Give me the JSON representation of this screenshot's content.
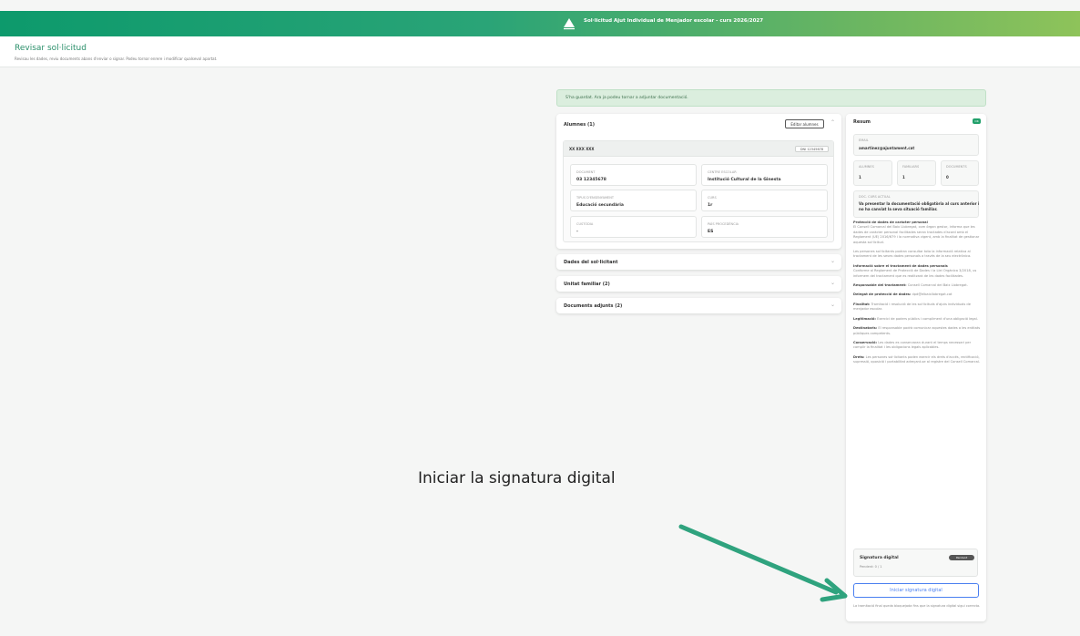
{
  "header": {
    "title": "Sol·licitud Ajut Individual de Menjador escolar - curs 2026/2027",
    "colors": {
      "green_start": "#0d9a6c",
      "green_end": "#8ec35a"
    }
  },
  "page": {
    "title": "Revisar sol·licitud",
    "subtitle": "Revisau les dades, reviu documents abans d'enviar o signar. Podeu tornar enrere i modificar qualsevol apartat."
  },
  "alert": {
    "text": "S'ha guardat. Ara ja podeu tornar a adjuntar documentació."
  },
  "students": {
    "title": "Alumnes (1)",
    "edit_label": "Editar alumnes",
    "card": {
      "name": "XX XXX XXX",
      "pill": "DNI 12345678",
      "fields": [
        {
          "label": "Document",
          "value": "03 12345678"
        },
        {
          "label": "Centre escolar",
          "value": "Institució Cultural de la Ginesta"
        },
        {
          "label": "Tipus d'ensenyament",
          "value": "Educació secundària"
        },
        {
          "label": "Curs",
          "value": "1r"
        },
        {
          "label": "Custòdia",
          "value": "-"
        },
        {
          "label": "País procedència",
          "value": "ES"
        }
      ]
    }
  },
  "sections": [
    {
      "title": "Dades del sol·licitant"
    },
    {
      "title": "Unitat familiar (2)"
    },
    {
      "title": "Documents adjunts (2)"
    }
  ],
  "summary": {
    "title": "Resum",
    "tag": "OK",
    "email_label": "Email",
    "email": "amartinez@ajuntament.cat",
    "stats": [
      {
        "label": "Alumnes",
        "value": "1"
      },
      {
        "label": "Familiars",
        "value": "1"
      },
      {
        "label": "Documents",
        "value": "0"
      }
    ],
    "doc_label": "Doc. curs actual",
    "doc_text": "Va presentar la documentació obligatòria al curs anterior i no ha canviat la seva situació familiar.",
    "legal": [
      {
        "head": "Protecció de dades de caràcter personal",
        "text": "El Consell Comarcal del Baix Llobregat, com òrgan gestor, informa que les dades de caràcter personal facilitades seran tractades d'acord amb el Reglament (UE) 2016/679 i la normativa vigent, amb la finalitat de gestionar aquesta sol·licitud."
      },
      {
        "head": "",
        "text": "Les persones sol·licitants podran consultar tota la informació relativa al tractament de les seves dades personals a través de la seu electrònica."
      },
      {
        "head": "Informació sobre el tractament de dades personals",
        "text": "Conforme al Reglament de Protecció de Dades i la Llei Orgànica 3/2018, us informem del tractament que es realitzarà de les dades facilitades."
      },
      {
        "head": "Responsable del tractament:",
        "text": "Consell Comarcal del Baix Llobregat."
      },
      {
        "head": "Delegat de protecció de dades:",
        "text": "dpd@elbaixllobregat.cat"
      },
      {
        "head": "Finalitat:",
        "text": "Tramitació i resolució de les sol·licituds d'ajuts individuals de menjador escolar."
      },
      {
        "head": "Legitimació:",
        "text": "Exercici de poders públics i compliment d'una obligació legal."
      },
      {
        "head": "Destinataris:",
        "text": "El responsable podrà comunicar aquestes dades a les entitats públiques competents."
      },
      {
        "head": "Conservació:",
        "text": "Les dades es conservaran durant el temps necessari per complir la finalitat i les obligacions legals aplicables."
      },
      {
        "head": "Drets:",
        "text": "Les persones sol·licitants poden exercir els drets d'accés, rectificació, supressió, oposició i portabilitat adreçant-se al registre del Consell Comarcal."
      }
    ],
    "signature": {
      "title": "Signatura digital",
      "subtitle": "Pendent: 0 / 1",
      "badge": "Pendent"
    },
    "sign_button": "Iniciar signatura digital",
    "footnote": "La tramitació final queda bloquejada fins que la signatura digital sigui correcta."
  },
  "annotation": {
    "caption": "Iniciar la signatura digital",
    "arrow_color": "#2fa37e"
  }
}
